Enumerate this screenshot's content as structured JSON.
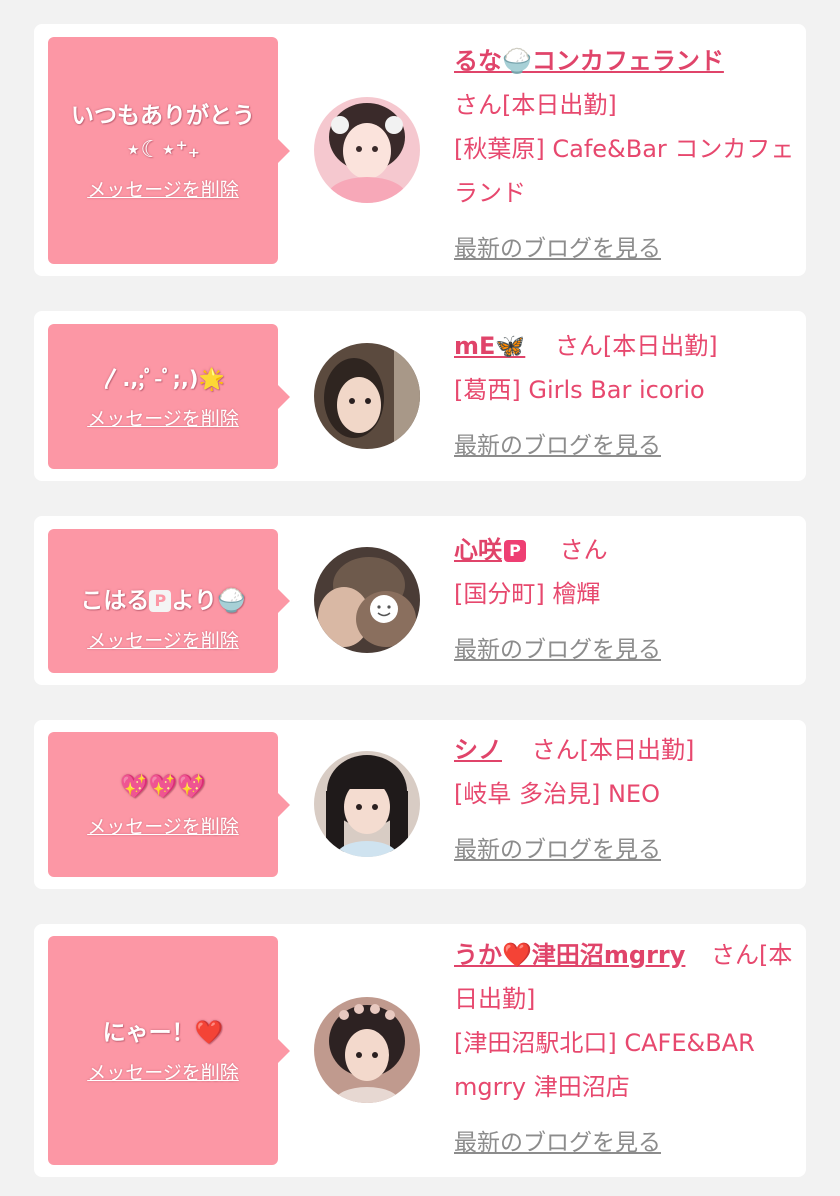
{
  "colors": {
    "page_bg": "#f2f2f2",
    "card_bg": "#ffffff",
    "bubble": "#fc97a5",
    "accent": "#e7486e",
    "link_gray": "#8c8c8c"
  },
  "cards": [
    {
      "message": "いつもありがとう\n⋆☾⋆⁺₊",
      "delete_label": "メッセージを削除",
      "name": "るな🍚コンカフェランド",
      "name_suffix": "さん[本日出勤]",
      "shop": "[秋葉原] Cafe&Bar コンカフェランド",
      "blog_label": "最新のブログを見る"
    },
    {
      "message": "〳.,;ﾟ-ﾟ;,)🌟",
      "delete_label": "メッセージを削除",
      "name": "mE🦋",
      "name_suffix": "さん[本日出勤]",
      "shop": "[葛西] Girls Bar icorio",
      "blog_label": "最新のブログを見る"
    },
    {
      "message_before_badge": "こはる",
      "message_badge": "P",
      "message_after_badge": "より🍚",
      "delete_label": "メッセージを削除",
      "name": "心咲",
      "name_badge": "P",
      "name_suffix": "さん",
      "shop": "[国分町] 檜輝",
      "blog_label": "最新のブログを見る"
    },
    {
      "message": "💖💖💖",
      "delete_label": "メッセージを削除",
      "name": "シノ",
      "name_suffix": "さん[本日出勤]",
      "shop": "[岐阜 多治見] NEO",
      "blog_label": "最新のブログを見る"
    },
    {
      "message": "にゃー！❤️",
      "delete_label": "メッセージを削除",
      "name": "うか❤️津田沼mgrry",
      "name_suffix": "さん[本日出勤]",
      "shop": "[津田沼駅北口] CAFE&BAR mgrry 津田沼店",
      "blog_label": "最新のブログを見る"
    }
  ]
}
